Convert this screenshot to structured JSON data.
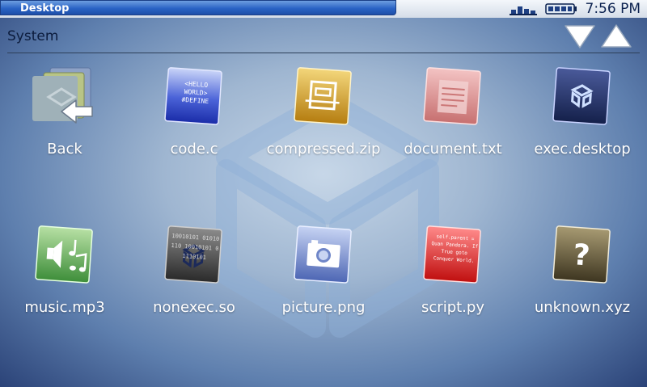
{
  "window": {
    "title": "Desktop"
  },
  "status": {
    "time": "7:56 PM",
    "network_icon": "network-icon",
    "battery_icon": "battery-icon"
  },
  "location": {
    "label": "System"
  },
  "nav": {
    "down_icon": "chevron-down-icon",
    "up_icon": "chevron-up-icon"
  },
  "files": [
    {
      "name": "Back",
      "icon": "back-icon"
    },
    {
      "name": "code.c",
      "icon": "c-source-icon",
      "tile_text": "<HELLO WORLD> #DEFINE"
    },
    {
      "name": "compressed.zip",
      "icon": "archive-icon"
    },
    {
      "name": "document.txt",
      "icon": "text-document-icon"
    },
    {
      "name": "exec.desktop",
      "icon": "executable-icon"
    },
    {
      "name": "music.mp3",
      "icon": "music-icon"
    },
    {
      "name": "nonexec.so",
      "icon": "library-icon",
      "tile_text": "10010101 01010110 10010101 01110101"
    },
    {
      "name": "picture.png",
      "icon": "image-icon"
    },
    {
      "name": "script.py",
      "icon": "script-icon",
      "tile_text": "self.parent = Quan Pandora. If True goto Conquer World."
    },
    {
      "name": "unknown.xyz",
      "icon": "unknown-file-icon"
    }
  ],
  "colors": {
    "title_bar": "#2a63c5",
    "code_tile": "#2f48c8",
    "zip_tile": "#d39a1c",
    "txt_tile": "#d98b8b",
    "exec_tile": "#23305a",
    "music_tile": "#6fb86a",
    "so_tile": "#3a3a3a",
    "png_tile": "#6f86c8",
    "py_tile": "#d81c1c",
    "unknown_tile": "#6b5e3d"
  }
}
